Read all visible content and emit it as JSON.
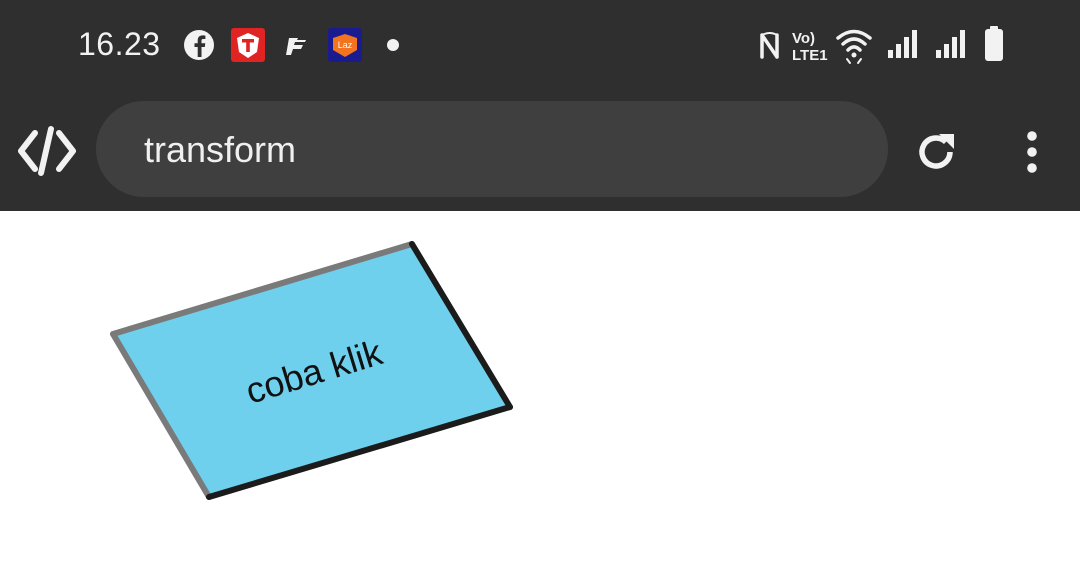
{
  "status_bar": {
    "time": "16.23",
    "notification_icons": [
      "facebook-icon",
      "t-app-icon",
      "f-app-icon",
      "lazada-icon",
      "dot-icon"
    ],
    "system_icons": [
      "nfc-icon",
      "volte-lte-icon",
      "wifi-icon",
      "signal-sim1-icon",
      "signal-sim2-icon",
      "battery-icon"
    ],
    "volte_top": "Vo)",
    "volte_bottom": "LTE1",
    "lazada_label": "Laz"
  },
  "browser": {
    "url": "transform",
    "left_icon": "code-brackets-icon",
    "reload_icon": "reload-icon",
    "menu_icon": "more-vert-icon"
  },
  "demo": {
    "box_text": "coba klik",
    "colors": {
      "box_fill": "#6fd0ee",
      "border_light": "#7a7a7a",
      "border_dark": "#1b1b1b"
    }
  }
}
